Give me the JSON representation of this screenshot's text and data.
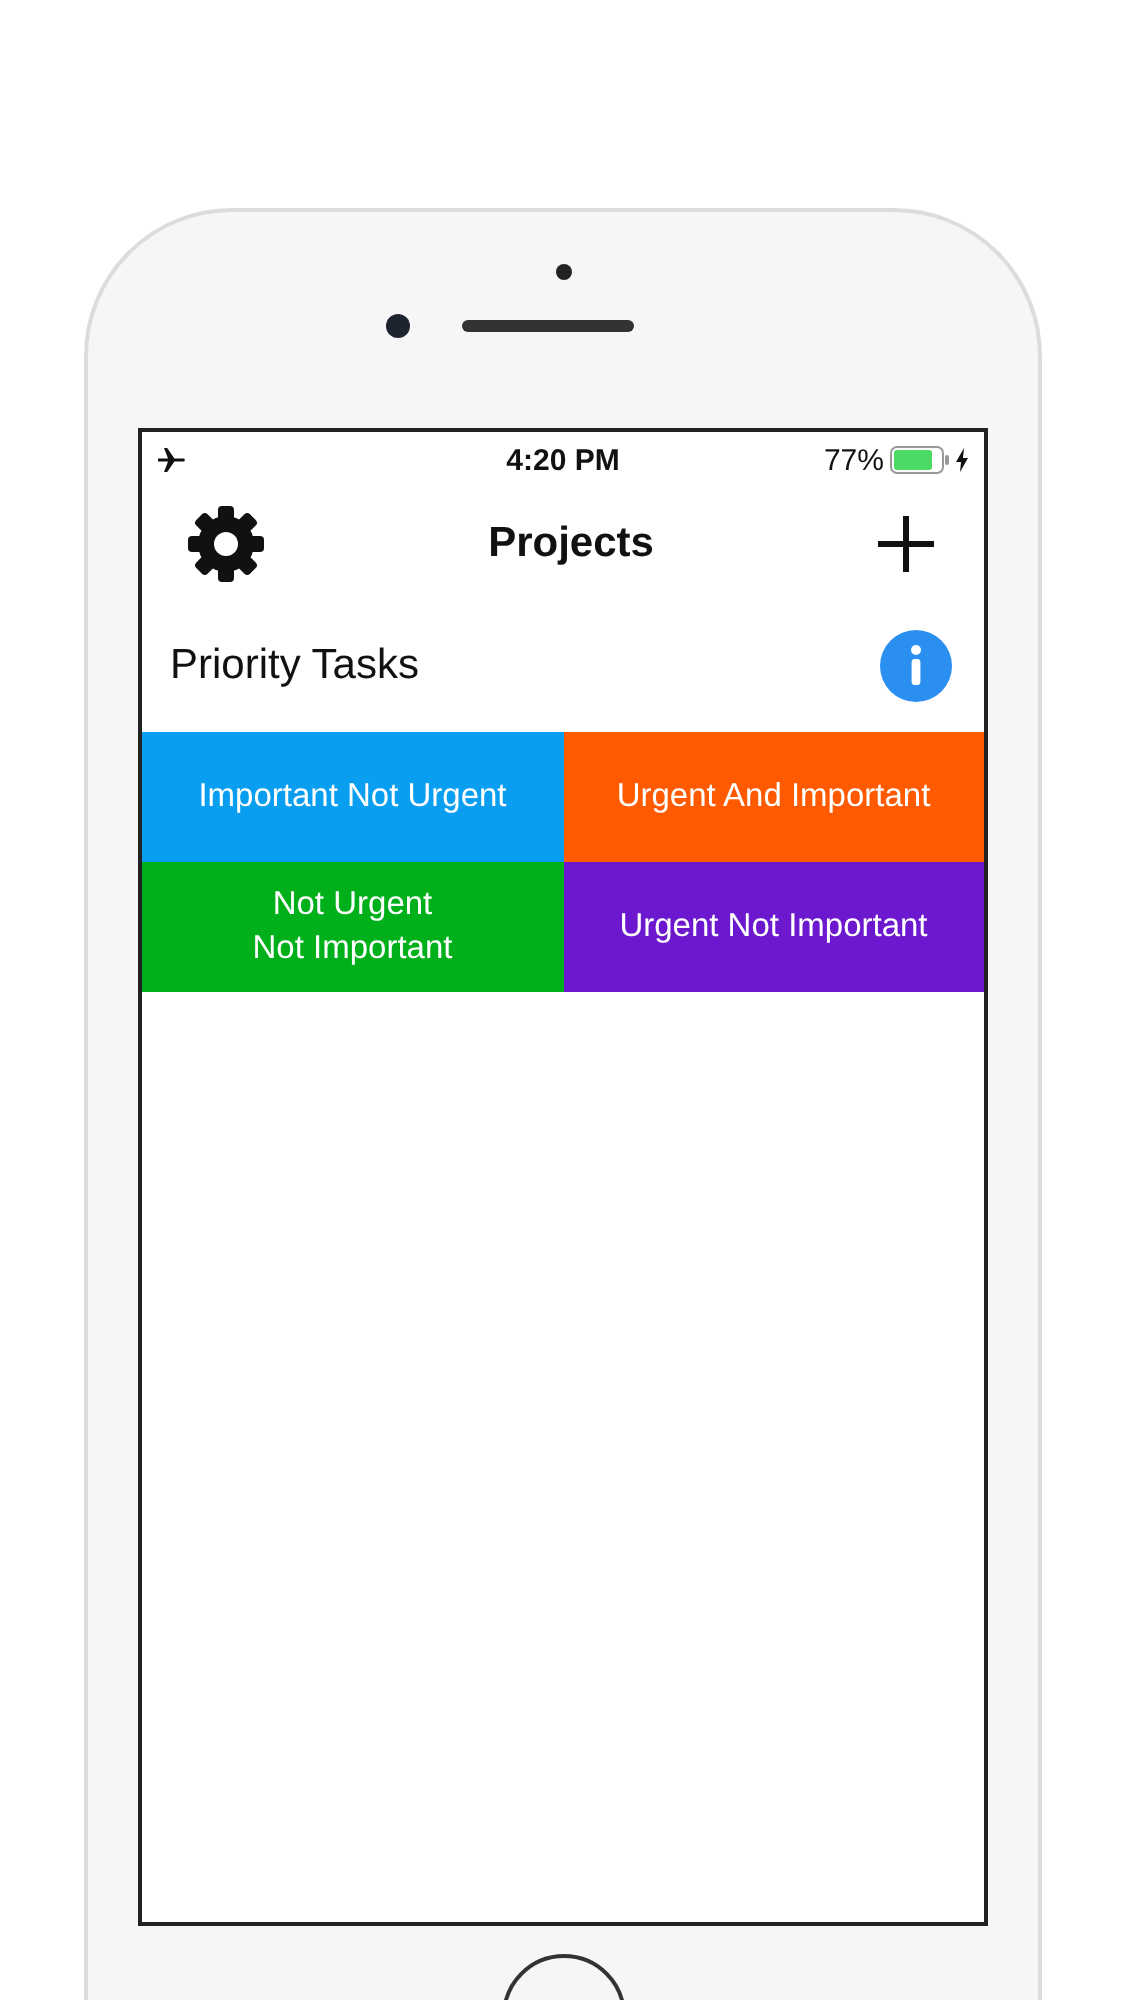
{
  "status_bar": {
    "time": "4:20 PM",
    "battery": "77%"
  },
  "nav_bar": {
    "title": "Projects"
  },
  "section": {
    "title": "Priority Tasks"
  },
  "quadrants": [
    {
      "label": "Important Not Urgent",
      "color": "#0a9ef0"
    },
    {
      "label": "Urgent And Important",
      "color": "#ff5a00"
    },
    {
      "label": "Not Urgent\nNot Important",
      "color": "#00b01a"
    },
    {
      "label": "Urgent Not Important",
      "color": "#6c18cf"
    }
  ]
}
